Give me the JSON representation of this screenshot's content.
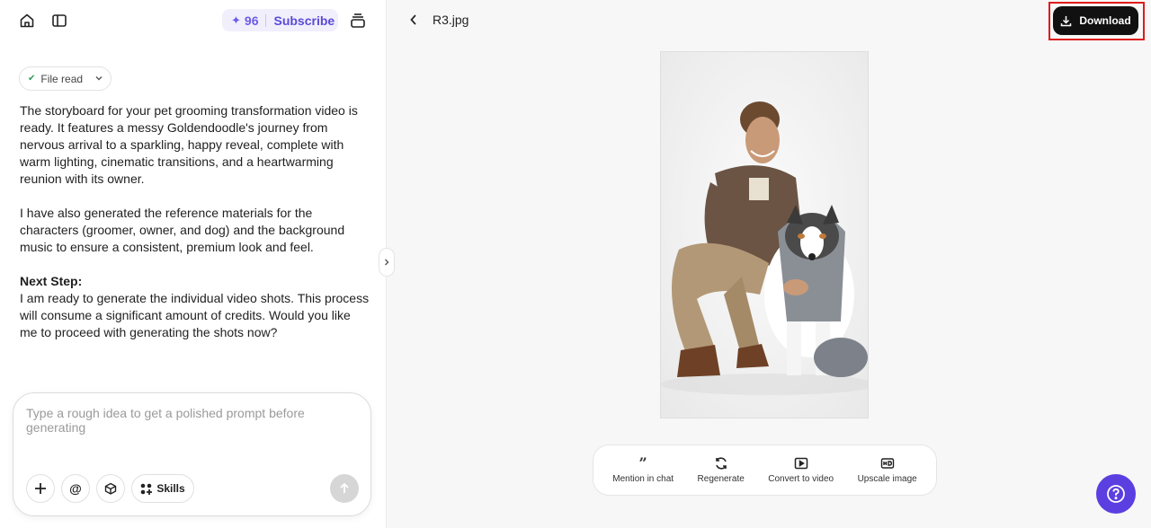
{
  "topbar": {
    "credits": "96",
    "subscribe_label": "Subscribe"
  },
  "chat": {
    "file_read_label": "File read",
    "paragraph1": "The storyboard for your pet grooming transformation video is ready. It features a messy Goldendoodle's journey from nervous arrival to a sparkling, happy reveal, complete with warm lighting, cinematic transitions, and a heartwarming reunion with its owner.",
    "paragraph2": "I have also generated the reference materials for the characters (groomer, owner, and dog) and the background music to ensure a consistent, premium look and feel.",
    "next_step_heading": "Next Step:",
    "paragraph3": "I am ready to generate the individual video shots. This process will consume a significant amount of credits. Would you like me to proceed with generating the shots now?"
  },
  "composer": {
    "placeholder": "Type a rough idea to get a polished prompt before generating",
    "skills_label": "Skills"
  },
  "preview": {
    "file_name": "R3.jpg",
    "download_label": "Download",
    "actions": [
      {
        "label": "Mention in chat",
        "icon": "quote-icon"
      },
      {
        "label": "Regenerate",
        "icon": "refresh-icon"
      },
      {
        "label": "Convert to video",
        "icon": "video-icon"
      },
      {
        "label": "Upscale image",
        "icon": "hd-icon"
      }
    ]
  },
  "colors": {
    "accent": "#5b3fe0",
    "highlight": "#e01b1b",
    "download_bg": "#111111"
  }
}
